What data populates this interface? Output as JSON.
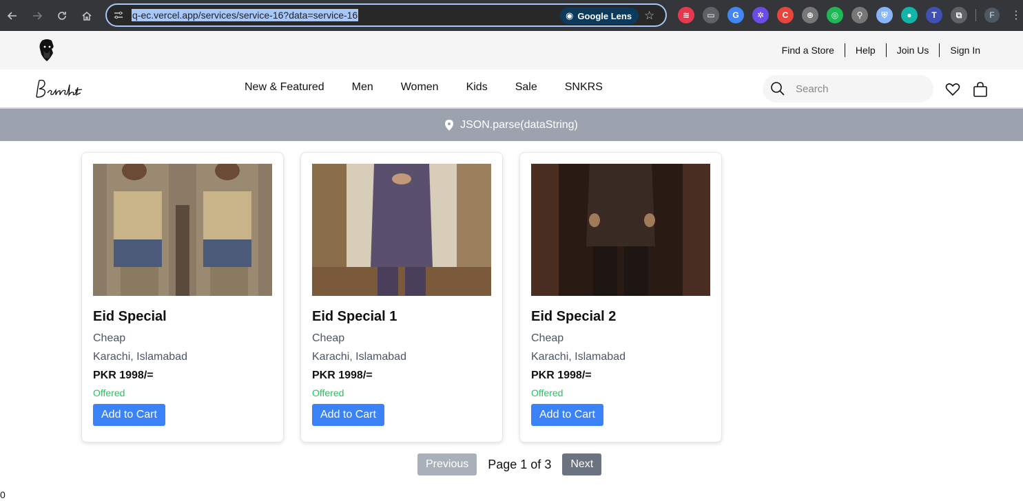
{
  "browser": {
    "url": "q-ec.vercel.app/services/service-16?data=service-16",
    "lens_label": "Google Lens",
    "profile_initial": "F",
    "extensions": [
      {
        "name": "ext-red-icon",
        "color": "#e53950",
        "glyph": "≋"
      },
      {
        "name": "ext-window-icon",
        "color": "#5f6368",
        "glyph": "▭"
      },
      {
        "name": "ext-translate-icon",
        "color": "#4285f4",
        "glyph": "G"
      },
      {
        "name": "ext-gear-icon",
        "color": "#6b4ce6",
        "glyph": "✲"
      },
      {
        "name": "ext-c-icon",
        "color": "#e8453c",
        "glyph": "C"
      },
      {
        "name": "ext-globe-icon",
        "color": "#777777",
        "glyph": "⊕"
      },
      {
        "name": "ext-target-icon",
        "color": "#1db954",
        "glyph": "◎"
      },
      {
        "name": "ext-search-icon",
        "color": "#777777",
        "glyph": "⚲"
      },
      {
        "name": "ext-shield-icon",
        "color": "#8ab4f8",
        "glyph": "⛨"
      },
      {
        "name": "ext-chat-icon",
        "color": "#12b5a7",
        "glyph": "●"
      },
      {
        "name": "ext-translate2-icon",
        "color": "#3f51b5",
        "glyph": "T"
      },
      {
        "name": "ext-puzzle-icon",
        "color": "#5f6368",
        "glyph": "⧉"
      }
    ]
  },
  "utility": {
    "links": [
      "Find a Store",
      "Help",
      "Join Us",
      "Sign In"
    ]
  },
  "nav": {
    "items": [
      "New & Featured",
      "Men",
      "Women",
      "Kids",
      "Sale",
      "SNKRS"
    ],
    "search_placeholder": "Search"
  },
  "banner": {
    "text": "JSON.parse(dataString)"
  },
  "products": [
    {
      "title": "Eid Special",
      "category": "Cheap",
      "location": "Karachi, Islamabad",
      "price": "PKR 1998/=",
      "status": "Offered",
      "button": "Add to Cart",
      "image": "product-photo-1"
    },
    {
      "title": "Eid Special 1",
      "category": "Cheap",
      "location": "Karachi, Islamabad",
      "price": "PKR 1998/=",
      "status": "Offered",
      "button": "Add to Cart",
      "image": "product-photo-2"
    },
    {
      "title": "Eid Special 2",
      "category": "Cheap",
      "location": "Karachi, Islamabad",
      "price": "PKR 1998/=",
      "status": "Offered",
      "button": "Add to Cart",
      "image": "product-photo-3"
    }
  ],
  "pagination": {
    "previous": "Previous",
    "label": "Page 1 of 3",
    "next": "Next"
  },
  "footer_stray": "0",
  "colors": {
    "accent": "#3b82f6",
    "status_green": "#22c55e",
    "banner_bg": "#9ca3af"
  }
}
